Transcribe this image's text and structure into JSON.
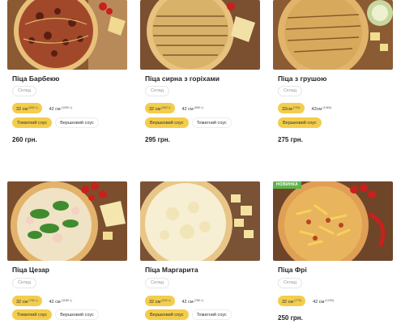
{
  "products": [
    {
      "title": "Піца Барбекю",
      "composition_label": "Склад",
      "sizes": [
        {
          "label": "32 см",
          "weight": "(660 г)",
          "active": true
        },
        {
          "label": "42 см",
          "weight": "(1050 г)",
          "active": false
        }
      ],
      "sauces": [
        {
          "label": "Томатний соус",
          "active": true
        },
        {
          "label": "Вершковий соус",
          "active": false
        }
      ],
      "price": "260 грн.",
      "badge": ""
    },
    {
      "title": "Піца сирна з горіхами",
      "composition_label": "Склад",
      "sizes": [
        {
          "label": "32 см",
          "weight": "(660 г)",
          "active": true
        },
        {
          "label": "42 см",
          "weight": "(960 г)",
          "active": false
        }
      ],
      "sauces": [
        {
          "label": "Вершковий соус",
          "active": true
        },
        {
          "label": "Томатний соус",
          "active": false
        }
      ],
      "price": "295 грн.",
      "badge": ""
    },
    {
      "title": "Піца з грушою",
      "composition_label": "Склад",
      "sizes": [
        {
          "label": "32см",
          "weight": "(700)",
          "active": true
        },
        {
          "label": "42см",
          "weight": "(1060)",
          "active": false
        }
      ],
      "sauces": [
        {
          "label": "Вершковий соус",
          "active": true
        }
      ],
      "price": "275 грн.",
      "badge": ""
    },
    {
      "title": "Піца Цезар",
      "composition_label": "Склад",
      "sizes": [
        {
          "label": "32 см",
          "weight": "(760 г)",
          "active": true
        },
        {
          "label": "42 см",
          "weight": "(1180 г)",
          "active": false
        }
      ],
      "sauces": [
        {
          "label": "Томатний соус",
          "active": true
        },
        {
          "label": "Вершковий соус",
          "active": false
        }
      ],
      "price": "",
      "badge": ""
    },
    {
      "title": "Піца Маргарита",
      "composition_label": "Склад",
      "sizes": [
        {
          "label": "32 см",
          "weight": "(540 г)",
          "active": true
        },
        {
          "label": "42 см",
          "weight": "(780 г)",
          "active": false
        }
      ],
      "sauces": [
        {
          "label": "Вершковий соус",
          "active": true
        },
        {
          "label": "Томатний соус",
          "active": false
        }
      ],
      "price": "",
      "badge": ""
    },
    {
      "title": "Піца Фрі",
      "composition_label": "Склад",
      "sizes": [
        {
          "label": "32 см",
          "weight": "(770)",
          "active": true
        },
        {
          "label": "42 см",
          "weight": "(1200)",
          "active": false
        }
      ],
      "sauces": [],
      "price": "250 грн.",
      "badge": "НОВИНКА"
    }
  ],
  "colors": {
    "accent": "#f3cd4c",
    "badge": "#5fb34a",
    "text": "#222222",
    "muted": "#999999"
  }
}
